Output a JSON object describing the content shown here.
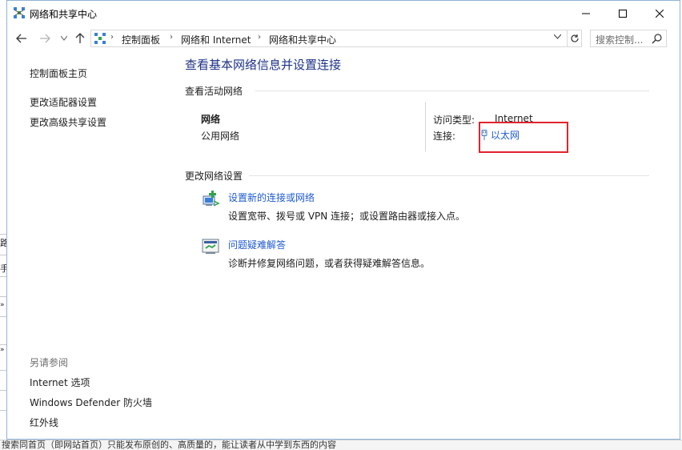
{
  "window": {
    "title": "网络和共享中心"
  },
  "nav": {
    "breadcrumbs": [
      "控制面板",
      "网络和 Internet",
      "网络和共享中心"
    ],
    "search_placeholder": "搜索控制..."
  },
  "sidebar": {
    "home": "控制面板主页",
    "links": [
      "更改适配器设置",
      "更改高级共享设置"
    ],
    "see_also_header": "另请参阅",
    "see_also": [
      "Internet 选项",
      "Windows Defender 防火墙",
      "红外线"
    ]
  },
  "main": {
    "title": "查看基本网络信息并设置连接",
    "active_section": "查看活动网络",
    "network": {
      "name": "网络",
      "type": "公用网络",
      "access_label": "访问类型:",
      "access_value": "Internet",
      "connection_label": "连接:",
      "connection_value": "以太网"
    },
    "change_section": "更改网络设置",
    "tasks": [
      {
        "link": "设置新的连接或网络",
        "desc": "设置宽带、拨号或 VPN 连接；或设置路由器或接入点。"
      },
      {
        "link": "问题疑难解答",
        "desc": "诊断并修复网络问题，或者获得疑难解答信息。"
      }
    ]
  },
  "background": {
    "bottom_text": "搜索同首页（即网站首页）只能发布原创的、高质量的，能让读者从中学到东西的内容",
    "left_glyphs": [
      "路",
      "手"
    ]
  },
  "colors": {
    "link": "#1e5ad2",
    "title": "#1e3287",
    "highlight_box": "#e0242b"
  }
}
